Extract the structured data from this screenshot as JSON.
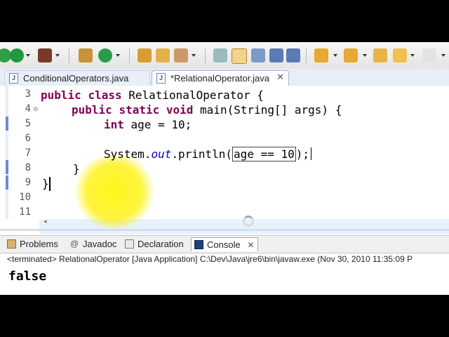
{
  "editor": {
    "tabs": [
      {
        "label": "ConditionalOperators.java"
      },
      {
        "label": "*RelationalOperator.java"
      }
    ],
    "line_numbers": [
      "3",
      "4",
      "5",
      "6",
      "7",
      "8",
      "9",
      "10",
      "11"
    ],
    "code": {
      "line3_kw1": "public",
      "line3_kw2": "class",
      "line3_rest": " RelationalOperator {",
      "line4_kw1": "public",
      "line4_kw2": "static",
      "line4_kw3": "void",
      "line4_rest": " main(String[] args) {",
      "line5_kw": "int",
      "line5_rest": " age = 10;",
      "line7_a": "System.",
      "line7_static": "out",
      "line7_b": ".println(",
      "line7_sel": "age == 10",
      "line7_c": ");",
      "line8": "}",
      "line9": "}"
    }
  },
  "views": {
    "tabs": [
      {
        "label": "Problems"
      },
      {
        "label": "Javadoc"
      },
      {
        "label": "Declaration"
      },
      {
        "label": "Console"
      }
    ],
    "console_close": "✕",
    "console_header": "<terminated> RelationalOperator [Java Application] C:\\Dev\\Java\\jre6\\bin\\javaw.exe (Nov 30, 2010 11:35:09 P",
    "output": "false"
  },
  "colors": {
    "keyword": "#7f0055",
    "static_field": "#0000c0",
    "highlight": "#ffee00"
  },
  "icons": [
    "run-icon",
    "debug-icon",
    "new-package-icon",
    "open-type-icon",
    "search-icon",
    "annotation-icon",
    "next-annotation-icon",
    "back-icon",
    "forward-icon"
  ]
}
